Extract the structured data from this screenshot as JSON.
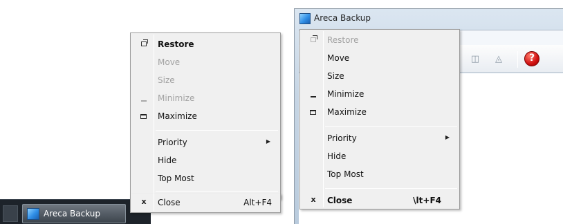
{
  "taskbar": {
    "app_title": "Areca Backup"
  },
  "left_menu": {
    "items": [
      {
        "label": "Restore",
        "state": "bold",
        "glyph": "restore"
      },
      {
        "label": "Move",
        "state": "disabled",
        "glyph": ""
      },
      {
        "label": "Size",
        "state": "disabled",
        "glyph": ""
      },
      {
        "label": "Minimize",
        "state": "disabled",
        "glyph": "minimize"
      },
      {
        "label": "Maximize",
        "state": "normal",
        "glyph": "maximize"
      },
      {
        "label": "Priority",
        "state": "normal",
        "submenu": true
      },
      {
        "label": "Hide",
        "state": "normal"
      },
      {
        "label": "Top Most",
        "state": "normal"
      },
      {
        "label": "Close",
        "state": "normal",
        "glyph_text": "x",
        "shortcut": "Alt+F4"
      }
    ]
  },
  "window": {
    "title": "Areca Backup",
    "help_glyph": "?"
  },
  "right_menu": {
    "items": [
      {
        "label": "Restore",
        "state": "disabled",
        "glyph": "restore"
      },
      {
        "label": "Move",
        "state": "normal"
      },
      {
        "label": "Size",
        "state": "normal"
      },
      {
        "label": "Minimize",
        "state": "normal",
        "glyph": "minimize"
      },
      {
        "label": "Maximize",
        "state": "normal",
        "glyph": "maximize"
      },
      {
        "label": "Priority",
        "state": "normal",
        "submenu": true
      },
      {
        "label": "Hide",
        "state": "normal"
      },
      {
        "label": "Top Most",
        "state": "normal"
      },
      {
        "label": "Close",
        "state": "bold",
        "glyph_text": "x",
        "shortcut": "\\lt+F4"
      }
    ]
  },
  "colors": {
    "taskbar": "#1d232a",
    "menu_bg": "#f0f0f0",
    "disabled_text": "#a2a2a2",
    "help_red": "#d01010"
  }
}
